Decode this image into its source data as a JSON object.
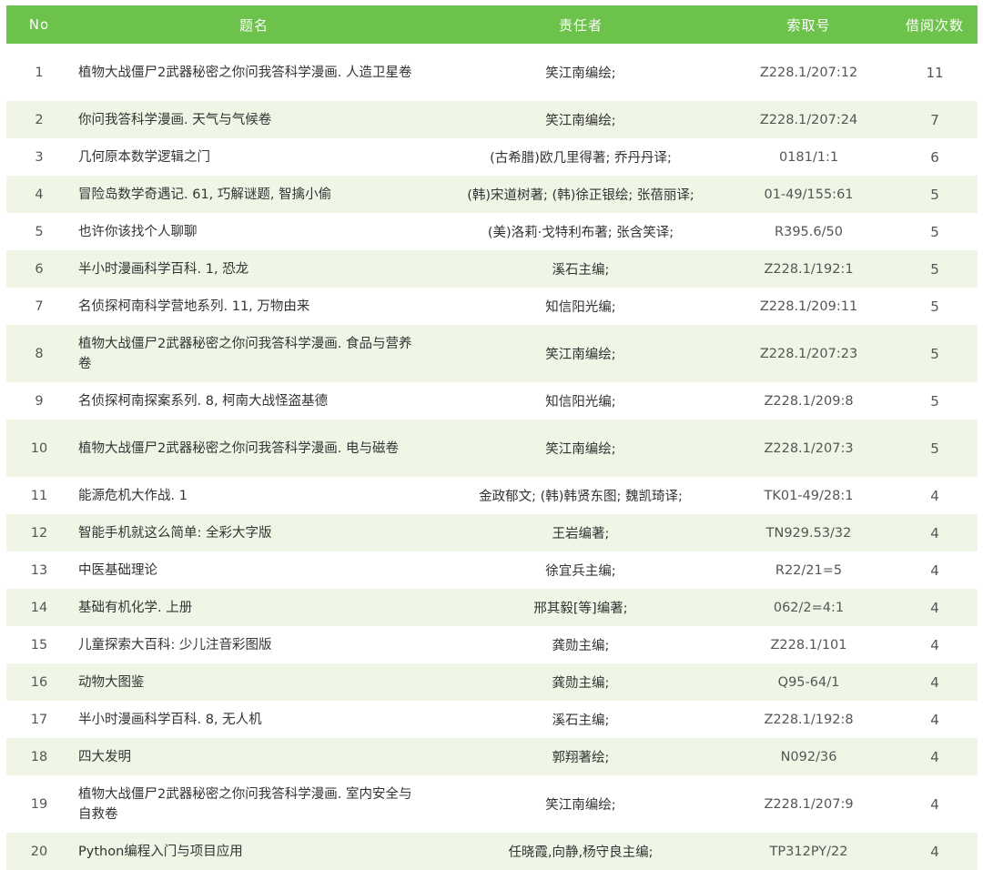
{
  "headers": [
    "No",
    "题名",
    "责任者",
    "索取号",
    "借阅次数"
  ],
  "rows": [
    {
      "no": "1",
      "title": "植物大战僵尸2武器秘密之你问我答科学漫画. 人造卫星卷",
      "author": "笑江南编绘;",
      "call": "Z228.1/207:12",
      "count": "11"
    },
    {
      "no": "2",
      "title": "你问我答科学漫画. 天气与气候卷",
      "author": "笑江南编绘;",
      "call": "Z228.1/207:24",
      "count": "7"
    },
    {
      "no": "3",
      "title": "几何原本数学逻辑之门",
      "author": "(古希腊)欧几里得著; 乔丹丹译;",
      "call": "0181/1:1",
      "count": "6"
    },
    {
      "no": "4",
      "title": "冒险岛数学奇遇记. 61, 巧解谜题, 智擒小偷",
      "author": "(韩)宋道树著; (韩)徐正银绘; 张蓓丽译;",
      "call": "01-49/155:61",
      "count": "5"
    },
    {
      "no": "5",
      "title": "也许你该找个人聊聊",
      "author": "(美)洛莉·戈特利布著; 张含笑译;",
      "call": "R395.6/50",
      "count": "5"
    },
    {
      "no": "6",
      "title": "半小时漫画科学百科. 1, 恐龙",
      "author": "溪石主编;",
      "call": "Z228.1/192:1",
      "count": "5"
    },
    {
      "no": "7",
      "title": "名侦探柯南科学营地系列. 11, 万物由来",
      "author": "知信阳光编;",
      "call": "Z228.1/209:11",
      "count": "5"
    },
    {
      "no": "8",
      "title": "植物大战僵尸2武器秘密之你问我答科学漫画. 食品与营养卷",
      "author": "笑江南编绘;",
      "call": "Z228.1/207:23",
      "count": "5"
    },
    {
      "no": "9",
      "title": "名侦探柯南探案系列. 8, 柯南大战怪盗基德",
      "author": "知信阳光编;",
      "call": "Z228.1/209:8",
      "count": "5"
    },
    {
      "no": "10",
      "title": "植物大战僵尸2武器秘密之你问我答科学漫画. 电与磁卷",
      "author": "笑江南编绘;",
      "call": "Z228.1/207:3",
      "count": "5"
    },
    {
      "no": "11",
      "title": "能源危机大作战. 1",
      "author": "金政郁文; (韩)韩贤东图; 魏凯琦译;",
      "call": "TK01-49/28:1",
      "count": "4"
    },
    {
      "no": "12",
      "title": "智能手机就这么简单: 全彩大字版",
      "author": "王岩编著;",
      "call": "TN929.53/32",
      "count": "4"
    },
    {
      "no": "13",
      "title": "中医基础理论",
      "author": "徐宜兵主编;",
      "call": "R22/21=5",
      "count": "4"
    },
    {
      "no": "14",
      "title": "基础有机化学. 上册",
      "author": "邢其毅[等]编著;",
      "call": "062/2=4:1",
      "count": "4"
    },
    {
      "no": "15",
      "title": "儿童探索大百科: 少儿注音彩图版",
      "author": "龚勋主编;",
      "call": "Z228.1/101",
      "count": "4"
    },
    {
      "no": "16",
      "title": "动物大图鉴",
      "author": "龚勋主编;",
      "call": "Q95-64/1",
      "count": "4"
    },
    {
      "no": "17",
      "title": "半小时漫画科学百科. 8, 无人机",
      "author": "溪石主编;",
      "call": "Z228.1/192:8",
      "count": "4"
    },
    {
      "no": "18",
      "title": "四大发明",
      "author": "郭翔著绘;",
      "call": "N092/36",
      "count": "4"
    },
    {
      "no": "19",
      "title": "植物大战僵尸2武器秘密之你问我答科学漫画. 室内安全与自救卷",
      "author": "笑江南编绘;",
      "call": "Z228.1/207:9",
      "count": "4"
    },
    {
      "no": "20",
      "title": "Python编程入门与项目应用",
      "author": "任晓霞,向静,杨守良主编;",
      "call": "TP312PY/22",
      "count": "4"
    }
  ]
}
